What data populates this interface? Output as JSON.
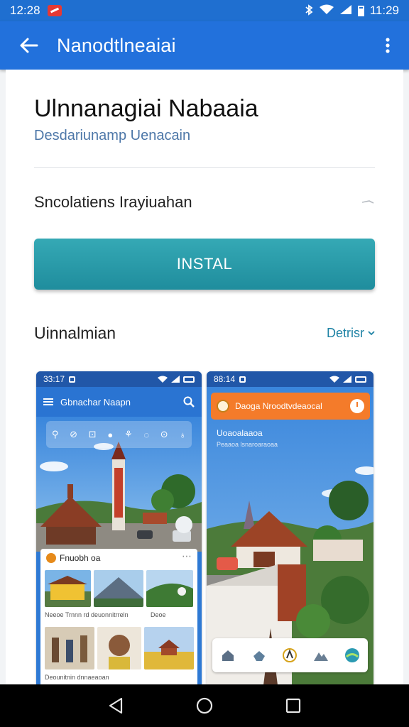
{
  "status_bar": {
    "time_left": "12:28",
    "time_right": "11:29"
  },
  "app_bar": {
    "title": "Nanodtlneaiai"
  },
  "app": {
    "name": "Ulnnanagiai Nabaaia",
    "developer": "Desdariunamp Uenacain",
    "info_row": "Sncolatiens Irayiuahan",
    "install_label": "INSTAL"
  },
  "screenshots_section": {
    "title": "Uinnalmian",
    "details_label": "Detrisr"
  },
  "screenshot_1": {
    "status_time": "33:17",
    "bar_title": "Gbnachar Naapn",
    "feed_title": "Fnuobh oa",
    "caption_1": "Neeoe Trnnn rd deuonnitrreln",
    "caption_2": "Deoe",
    "caption_3": "Deounitnin dnnaeaoan"
  },
  "screenshot_2": {
    "status_time": "88:14",
    "banner_text": "Daoga Nroodtvdeaocal",
    "title": "Uoaoalaaoa",
    "subtitle": "Peaaoa lsnaroaraoaa"
  },
  "colors": {
    "status_bar": "#1f6fd0",
    "app_bar": "#2271dc",
    "install_button": "#2a9ba9",
    "link": "#1f83a5",
    "banner": "#f47b2a"
  }
}
